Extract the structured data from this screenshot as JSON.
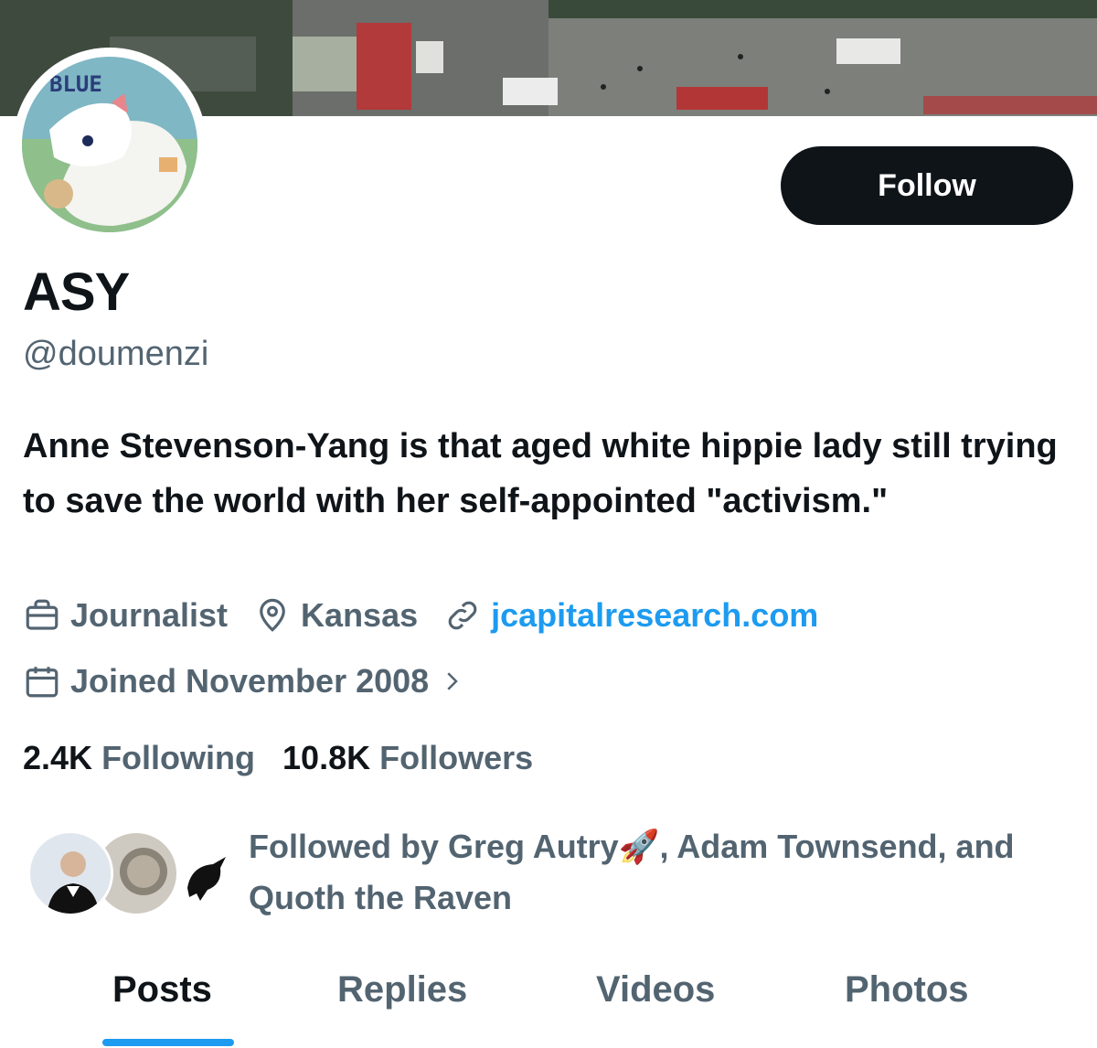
{
  "profile": {
    "display_name": "ASY",
    "handle": "@doumenzi",
    "bio": "Anne Stevenson-Yang is that aged white hippie lady still trying to save the world with her self-appointed \"activism.\"",
    "avatar_text": "BLUE",
    "follow_label": "Follow"
  },
  "meta": {
    "profession": "Journalist",
    "location": "Kansas",
    "website": "jcapitalresearch.com",
    "joined": "Joined November 2008"
  },
  "stats": {
    "following_count": "2.4K",
    "following_label": "Following",
    "followers_count": "10.8K",
    "followers_label": "Followers"
  },
  "followed_by": {
    "prefix": "Followed by Greg Autry",
    "emoji": "🚀",
    "rest": ", Adam Townsend, and Quoth the Raven"
  },
  "tabs": [
    "Posts",
    "Replies",
    "Videos",
    "Photos"
  ],
  "colors": {
    "accent": "#1d9bf0",
    "text_primary": "#0f1419",
    "text_secondary": "#536471",
    "button_bg": "#0f1419"
  }
}
